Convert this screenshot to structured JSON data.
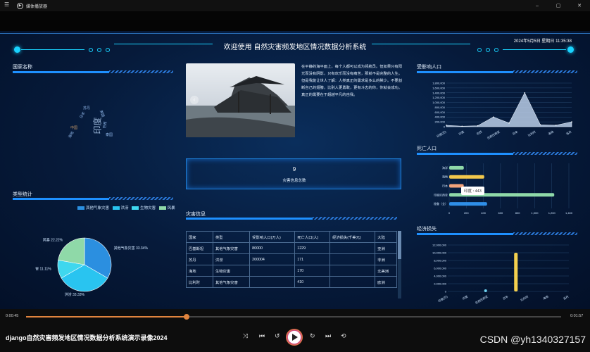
{
  "window": {
    "menu_icon": "menu-icon",
    "app_title": "媒体播放器",
    "minimize": "–",
    "maximize": "▢",
    "close": "✕"
  },
  "dashboard": {
    "title": "欢迎使用 自然灾害频发地区情况数据分析系统",
    "datetime": "2024年5月5日 星期日 11:35:38",
    "country_section": {
      "title": "国家名称",
      "words": [
        "印度",
        "日本",
        "美国",
        "中国",
        "巴西",
        "苏丹",
        "海地",
        "泰国",
        "菲律宾",
        "印度尼西亚",
        "比利时",
        "秘鲁"
      ]
    },
    "type_section": {
      "title": "类型统计",
      "legend": [
        "其他气象灾害",
        "洪涝",
        "生物灾害",
        "风暴"
      ],
      "colors": [
        "#2b8fe0",
        "#29c4f0",
        "#3fd7ee",
        "#8fd9a8"
      ],
      "labels": [
        "其他气象灾害 33.34%",
        "洪涝 33.33%",
        "生物灾害 11.11%",
        "风暴 22.22%"
      ]
    },
    "description": "在平静的海平面上，每个人都可以成为领航员。但如果只有阳光而没有阴影，只有欢乐而没有痛苦，那就不是完整的人生。但是我能让世人了解：人类真正的需求是多么的稀少。不要割断自己的翅膀，比别人更勇敢，更有斗志的你，你就会成功。真正的需要在于超越平凡的自我。",
    "count": {
      "value": "9",
      "label": "灾害信息总数"
    },
    "disaster_section": {
      "title": "灾害信息",
      "columns": [
        "国家",
        "类型",
        "受影响人口(万人)",
        "死亡人口(人)",
        "经济损失(千美元)",
        "大陆"
      ],
      "rows": [
        [
          "巴基斯坦",
          "其他气象灾害",
          "80000",
          "1229",
          "",
          "亚洲"
        ],
        [
          "苏丹",
          "洪涝",
          "200004",
          "171",
          "",
          "非洲"
        ],
        [
          "海地",
          "生物灾害",
          "",
          "170",
          "",
          "北美洲"
        ],
        [
          "比利时",
          "其他气象灾害",
          "",
          "410",
          "",
          "欧洲"
        ]
      ]
    },
    "affected_section": {
      "title": "受影响人口"
    },
    "death_section": {
      "title": "死亡人口",
      "tooltip": "印度 : 443"
    },
    "economic_section": {
      "title": "经济损失"
    }
  },
  "chart_data": [
    {
      "type": "area",
      "title": "受影响人口",
      "categories": [
        "印度(巴基斯坦)",
        "印度",
        "巴西",
        "美国(洪涝)",
        "日本",
        "日本(洪)",
        "比利时",
        "秘鲁",
        "苏丹"
      ],
      "values": [
        60000,
        20000,
        40000,
        400000,
        150000,
        1400000,
        80000,
        60000,
        200000
      ],
      "ylim": [
        0,
        1800000
      ],
      "yticks": [
        "0",
        "200,000",
        "400,000",
        "600,000",
        "800,000",
        "1,000,000",
        "1,200,000",
        "1,400,000",
        "1,600,000",
        "1,800,000"
      ],
      "xticks": [
        "印度(巴)",
        "印度",
        "巴西",
        "巴西巴西亚",
        "日本",
        "比利时",
        "海地",
        "苏丹"
      ]
    },
    {
      "type": "bar",
      "title": "死亡人口",
      "categories": [
        "秘鲁（全）",
        "印度尼西亚",
        "日本",
        "海地",
        "海洋"
      ],
      "values": [
        443,
        1229,
        170,
        410,
        171
      ],
      "colors": [
        "#2f8fe8",
        "#8fd9a8",
        "#f2a27a",
        "#f2c84c",
        "#8fd9a8"
      ],
      "xlim": [
        0,
        1400
      ],
      "xticks": [
        "0",
        "200",
        "400",
        "600",
        "800",
        "1,000",
        "1,200",
        "1,400"
      ]
    },
    {
      "type": "bar",
      "title": "经济损失",
      "categories": [
        "印度(巴)",
        "印度",
        "巴西巴西亚",
        "巴西",
        "日本",
        "比利时",
        "海地",
        "苏丹"
      ],
      "values": [
        0,
        0,
        0,
        0,
        10000000,
        0,
        0,
        0
      ],
      "ylim": [
        0,
        12000000
      ],
      "yticks": [
        "0",
        "2,000,000",
        "4,000,000",
        "6,000,000",
        "8,000,000",
        "10,000,000",
        "12,000,000"
      ],
      "xticks": [
        "印度(巴)",
        "印度",
        "巴西巴西亚",
        "日本",
        "比利时",
        "海地",
        "苏丹"
      ]
    },
    {
      "type": "pie",
      "title": "类型统计",
      "categories": [
        "其他气象灾害",
        "洪涝",
        "生物灾害",
        "风暴"
      ],
      "values": [
        33.34,
        33.33,
        11.11,
        22.22
      ]
    }
  ],
  "player": {
    "elapsed": "0:00:45",
    "total": "0:01:57",
    "progress": 0.3,
    "video_title": "django自然灾害频发地区情况数据分析系统演示录像2024",
    "watermark": "CSDN @yh1340327157"
  }
}
